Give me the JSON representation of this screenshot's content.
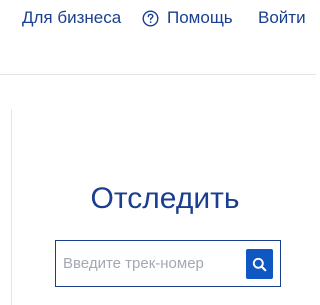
{
  "header": {
    "business_link": "Для бизнеса",
    "help_link": "Помощь",
    "login_link": "Войти"
  },
  "tracking": {
    "title": "Отследить",
    "input_placeholder": "Введите трек-номер",
    "input_value": ""
  },
  "icons": {
    "help": "question-circle-icon",
    "search": "magnifier-icon"
  },
  "colors": {
    "link": "#1a3f8f",
    "accent": "#0f57c3",
    "divider": "#e2e4e8",
    "placeholder": "#a3a8b1"
  }
}
